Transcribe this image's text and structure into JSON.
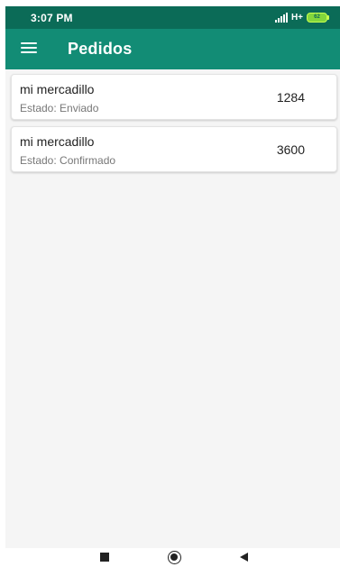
{
  "status_bar": {
    "time": "3:07 PM",
    "network": "H+",
    "battery_percent": "62",
    "colors": {
      "background": "#0b6b57",
      "battery": "#83d63c"
    },
    "icons": [
      "signal-icon",
      "battery-icon"
    ]
  },
  "app_bar": {
    "title": "Pedidos",
    "menu_icon": "menu-icon",
    "color": "#128c75"
  },
  "orders": [
    {
      "name": "mi mercadillo",
      "status_label": "Estado: ",
      "status_value": "Enviado",
      "total": "1284"
    },
    {
      "name": "mi mercadillo",
      "status_label": "Estado: ",
      "status_value": "Confirmado",
      "total": "3600"
    }
  ],
  "navigation_bar": {
    "icons": [
      "recent-apps-icon",
      "home-icon",
      "back-icon"
    ]
  }
}
